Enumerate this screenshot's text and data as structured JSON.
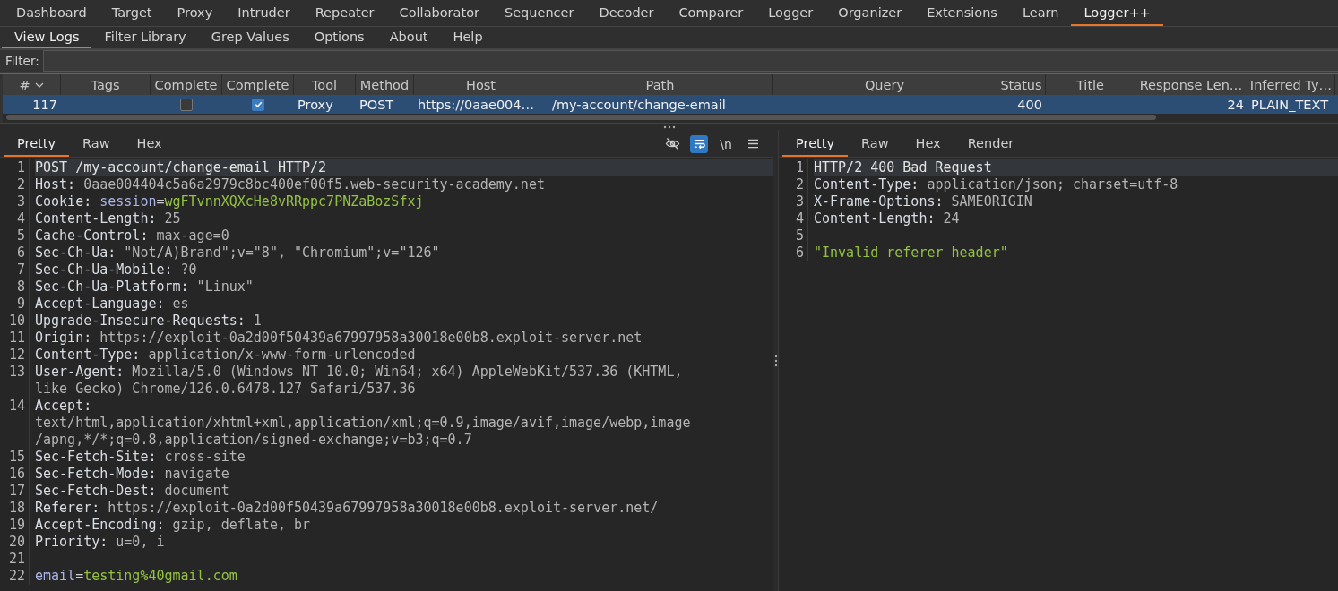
{
  "top_tabs": [
    {
      "label": "Dashboard",
      "selected": false
    },
    {
      "label": "Target",
      "selected": false
    },
    {
      "label": "Proxy",
      "selected": false
    },
    {
      "label": "Intruder",
      "selected": false
    },
    {
      "label": "Repeater",
      "selected": false
    },
    {
      "label": "Collaborator",
      "selected": false
    },
    {
      "label": "Sequencer",
      "selected": false
    },
    {
      "label": "Decoder",
      "selected": false
    },
    {
      "label": "Comparer",
      "selected": false
    },
    {
      "label": "Logger",
      "selected": false
    },
    {
      "label": "Organizer",
      "selected": false
    },
    {
      "label": "Extensions",
      "selected": false
    },
    {
      "label": "Learn",
      "selected": false
    },
    {
      "label": "Logger++",
      "selected": true
    }
  ],
  "sub_tabs": [
    {
      "label": "View Logs",
      "selected": true
    },
    {
      "label": "Filter Library",
      "selected": false
    },
    {
      "label": "Grep Values",
      "selected": false
    },
    {
      "label": "Options",
      "selected": false
    },
    {
      "label": "About",
      "selected": false
    },
    {
      "label": "Help",
      "selected": false
    }
  ],
  "filter": {
    "label": "Filter:"
  },
  "table": {
    "columns": [
      {
        "label": "#",
        "sorted": true
      },
      {
        "label": "Tags",
        "sorted": false
      },
      {
        "label": "Complete",
        "sorted": false
      },
      {
        "label": "Complete",
        "sorted": false
      },
      {
        "label": "Tool",
        "sorted": false
      },
      {
        "label": "Method",
        "sorted": false
      },
      {
        "label": "Host",
        "sorted": false
      },
      {
        "label": "Path",
        "sorted": false
      },
      {
        "label": "Query",
        "sorted": false
      },
      {
        "label": "Status",
        "sorted": false
      },
      {
        "label": "Title",
        "sorted": false
      },
      {
        "label": "Response Len…",
        "sorted": false
      },
      {
        "label": "Inferred Ty…",
        "sorted": false
      }
    ],
    "rows": [
      {
        "selected": true,
        "cells": [
          {
            "kind": "number",
            "text": "117"
          },
          {
            "kind": "empty"
          },
          {
            "kind": "checkbox",
            "checked": false
          },
          {
            "kind": "checkbox",
            "checked": true
          },
          {
            "kind": "text",
            "text": "Proxy"
          },
          {
            "kind": "text",
            "text": "POST"
          },
          {
            "kind": "text",
            "text": "https://0aae004…"
          },
          {
            "kind": "text",
            "text": "/my-account/change-email"
          },
          {
            "kind": "empty"
          },
          {
            "kind": "number",
            "text": "400"
          },
          {
            "kind": "empty"
          },
          {
            "kind": "number",
            "text": "24"
          },
          {
            "kind": "text",
            "text": "PLAIN_TEXT"
          }
        ]
      }
    ]
  },
  "request": {
    "tabs": [
      {
        "label": "Pretty",
        "selected": true
      },
      {
        "label": "Raw",
        "selected": false
      },
      {
        "label": "Hex",
        "selected": false
      }
    ],
    "hide_non_printing": false,
    "wrap_lines": true,
    "newline_toggle": "\\n",
    "lines": [
      {
        "number": "1",
        "highlighted": true,
        "rows": [
          [
            {
              "kind": "plain",
              "text": "POST /my-account/change-email HTTP/2"
            }
          ]
        ]
      },
      {
        "number": "2",
        "highlighted": false,
        "rows": [
          [
            {
              "kind": "key",
              "text": "Host:"
            },
            {
              "kind": "value",
              "text": " 0aae004404c5a6a2979c8bc400ef00f5.web-security-academy.net"
            }
          ]
        ]
      },
      {
        "number": "3",
        "highlighted": false,
        "rows": [
          [
            {
              "kind": "key",
              "text": "Cookie:"
            },
            {
              "kind": "value",
              "text": " "
            },
            {
              "kind": "param",
              "text": "session"
            },
            {
              "kind": "op",
              "text": "="
            },
            {
              "kind": "string",
              "text": "wgFTvnnXQXcHe8vRRppc7PNZaBozSfxj"
            }
          ]
        ]
      },
      {
        "number": "4",
        "highlighted": false,
        "rows": [
          [
            {
              "kind": "key",
              "text": "Content-Length:"
            },
            {
              "kind": "value",
              "text": " 25"
            }
          ]
        ]
      },
      {
        "number": "5",
        "highlighted": false,
        "rows": [
          [
            {
              "kind": "key",
              "text": "Cache-Control:"
            },
            {
              "kind": "value",
              "text": " max-age=0"
            }
          ]
        ]
      },
      {
        "number": "6",
        "highlighted": false,
        "rows": [
          [
            {
              "kind": "key",
              "text": "Sec-Ch-Ua:"
            },
            {
              "kind": "value",
              "text": " \"Not/A)Brand\";v=\"8\", \"Chromium\";v=\"126\""
            }
          ]
        ]
      },
      {
        "number": "7",
        "highlighted": false,
        "rows": [
          [
            {
              "kind": "key",
              "text": "Sec-Ch-Ua-Mobile:"
            },
            {
              "kind": "value",
              "text": " ?0"
            }
          ]
        ]
      },
      {
        "number": "8",
        "highlighted": false,
        "rows": [
          [
            {
              "kind": "key",
              "text": "Sec-Ch-Ua-Platform:"
            },
            {
              "kind": "value",
              "text": " \"Linux\""
            }
          ]
        ]
      },
      {
        "number": "9",
        "highlighted": false,
        "rows": [
          [
            {
              "kind": "key",
              "text": "Accept-Language:"
            },
            {
              "kind": "value",
              "text": " es"
            }
          ]
        ]
      },
      {
        "number": "10",
        "highlighted": false,
        "rows": [
          [
            {
              "kind": "key",
              "text": "Upgrade-Insecure-Requests:"
            },
            {
              "kind": "value",
              "text": " 1"
            }
          ]
        ]
      },
      {
        "number": "11",
        "highlighted": false,
        "rows": [
          [
            {
              "kind": "key",
              "text": "Origin:"
            },
            {
              "kind": "value",
              "text": " https://exploit-0a2d00f50439a67997958a30018e00b8.exploit-server.net"
            }
          ]
        ]
      },
      {
        "number": "12",
        "highlighted": false,
        "rows": [
          [
            {
              "kind": "key",
              "text": "Content-Type:"
            },
            {
              "kind": "value",
              "text": " application/x-www-form-urlencoded"
            }
          ]
        ]
      },
      {
        "number": "13",
        "highlighted": false,
        "rows": [
          [
            {
              "kind": "key",
              "text": "User-Agent:"
            },
            {
              "kind": "value",
              "text": " Mozilla/5.0 (Windows NT 10.0; Win64; x64) AppleWebKit/537.36 (KHTML,"
            }
          ],
          [
            {
              "kind": "value",
              "text": "like Gecko) Chrome/126.0.6478.127 Safari/537.36"
            }
          ]
        ]
      },
      {
        "number": "14",
        "highlighted": false,
        "rows": [
          [
            {
              "kind": "key",
              "text": "Accept:"
            }
          ],
          [
            {
              "kind": "value",
              "text": "text/html,application/xhtml+xml,application/xml;q=0.9,image/avif,image/webp,image"
            }
          ],
          [
            {
              "kind": "value",
              "text": "/apng,*/*;q=0.8,application/signed-exchange;v=b3;q=0.7"
            }
          ]
        ]
      },
      {
        "number": "15",
        "highlighted": false,
        "rows": [
          [
            {
              "kind": "key",
              "text": "Sec-Fetch-Site:"
            },
            {
              "kind": "value",
              "text": " cross-site"
            }
          ]
        ]
      },
      {
        "number": "16",
        "highlighted": false,
        "rows": [
          [
            {
              "kind": "key",
              "text": "Sec-Fetch-Mode:"
            },
            {
              "kind": "value",
              "text": " navigate"
            }
          ]
        ]
      },
      {
        "number": "17",
        "highlighted": false,
        "rows": [
          [
            {
              "kind": "key",
              "text": "Sec-Fetch-Dest:"
            },
            {
              "kind": "value",
              "text": " document"
            }
          ]
        ]
      },
      {
        "number": "18",
        "highlighted": false,
        "rows": [
          [
            {
              "kind": "key",
              "text": "Referer:"
            },
            {
              "kind": "value",
              "text": " https://exploit-0a2d00f50439a67997958a30018e00b8.exploit-server.net/"
            }
          ]
        ]
      },
      {
        "number": "19",
        "highlighted": false,
        "rows": [
          [
            {
              "kind": "key",
              "text": "Accept-Encoding:"
            },
            {
              "kind": "value",
              "text": " gzip, deflate, br"
            }
          ]
        ]
      },
      {
        "number": "20",
        "highlighted": false,
        "rows": [
          [
            {
              "kind": "key",
              "text": "Priority:"
            },
            {
              "kind": "value",
              "text": " u=0, i"
            }
          ]
        ]
      },
      {
        "number": "21",
        "highlighted": false
      },
      {
        "number": "22",
        "highlighted": false,
        "rows": [
          [
            {
              "kind": "param",
              "text": "email"
            },
            {
              "kind": "op",
              "text": "="
            },
            {
              "kind": "string",
              "text": "testing%40gmail.com"
            }
          ]
        ]
      }
    ]
  },
  "response": {
    "tabs": [
      {
        "label": "Pretty",
        "selected": true
      },
      {
        "label": "Raw",
        "selected": false
      },
      {
        "label": "Hex",
        "selected": false
      },
      {
        "label": "Render",
        "selected": false
      }
    ],
    "lines": [
      {
        "number": "1",
        "highlighted": true,
        "rows": [
          [
            {
              "kind": "plain",
              "text": "HTTP/2 400 Bad Request"
            }
          ]
        ]
      },
      {
        "number": "2",
        "highlighted": false,
        "rows": [
          [
            {
              "kind": "key",
              "text": "Content-Type:"
            },
            {
              "kind": "value",
              "text": " application/json; charset=utf-8"
            }
          ]
        ]
      },
      {
        "number": "3",
        "highlighted": false,
        "rows": [
          [
            {
              "kind": "key",
              "text": "X-Frame-Options:"
            },
            {
              "kind": "value",
              "text": " SAMEORIGIN"
            }
          ]
        ]
      },
      {
        "number": "4",
        "highlighted": false,
        "rows": [
          [
            {
              "kind": "key",
              "text": "Content-Length:"
            },
            {
              "kind": "value",
              "text": " 24"
            }
          ]
        ]
      },
      {
        "number": "5",
        "highlighted": false
      },
      {
        "number": "6",
        "highlighted": false,
        "rows": [
          [
            {
              "kind": "string",
              "text": "\"Invalid referer header\""
            }
          ]
        ]
      }
    ]
  }
}
